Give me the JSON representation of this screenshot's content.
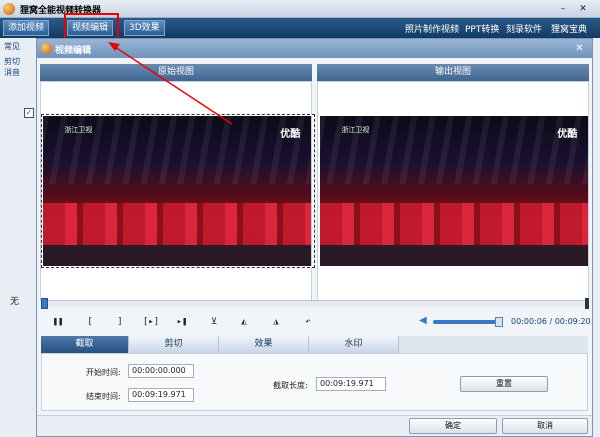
{
  "app": {
    "title": "狸窝全能视频转换器",
    "toolbar_tabs": [
      "添加视频",
      "视频编辑",
      "3D效果"
    ],
    "toolbar_links": [
      "照片制作视频",
      "PPT转换",
      "刻录软件",
      "狸窝宝典"
    ],
    "left_panel_texts": [
      "常见",
      "剪切",
      "消音",
      "无"
    ]
  },
  "dialog": {
    "title": "视频编辑",
    "original_view_label": "原始视图",
    "output_view_label": "输出视图",
    "watermark_text": "优酷",
    "channel_text": "浙江卫视",
    "time_current": "00:00:06",
    "time_total": "00:09:20",
    "time_separator": " / ",
    "volume_level_percent": 95,
    "tabs": [
      "截取",
      "剪切",
      "效果",
      "水印"
    ],
    "active_tab": "截取",
    "start_time_label": "开始时间:",
    "start_time_value": "00:00:00.000",
    "end_time_label": "结束时间:",
    "end_time_value": "00:09:19.971",
    "clip_length_label": "截取长度:",
    "clip_length_value": "00:09:19.971",
    "reset_label": "重置",
    "ok_label": "确定",
    "cancel_label": "取消"
  },
  "controls": {
    "play_pause": "❚❚",
    "mark_in": "[",
    "mark_out": "]",
    "frame_step": "[▸]",
    "next": "▸❚",
    "split_icon": "⊻",
    "flip_icon": "◭",
    "rotate_icon": "◮",
    "undo_icon": "↶"
  },
  "icons": [
    "app-logo-icon",
    "close-icon",
    "volume-icon",
    "list-checkbox-icon"
  ],
  "colors": {
    "accent": "#2d5f94",
    "annotation": "#e00000"
  }
}
